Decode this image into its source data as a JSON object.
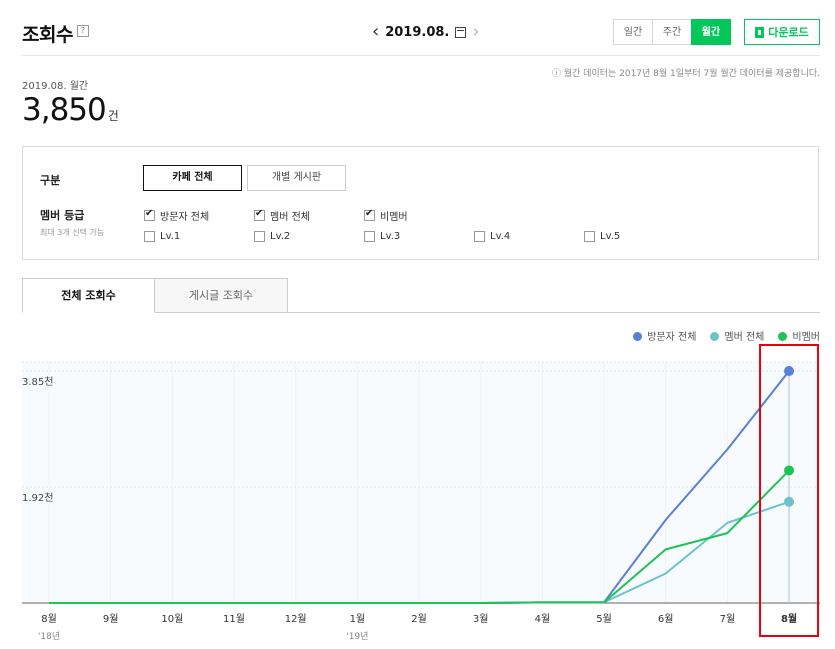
{
  "header": {
    "title": "조회수",
    "help": "?",
    "date": "2019.08.",
    "view_modes": [
      "일간",
      "주간",
      "월간"
    ],
    "active_mode": "월간",
    "download_label": "다운로드"
  },
  "notice": "ⓘ 월간 데이터는 2017년 8월 1일부터 7월 월간 데이터를 제공합니다.",
  "summary": {
    "period": "2019.08. 월간",
    "value": "3,850",
    "unit": "건"
  },
  "filter": {
    "category_label": "구분",
    "category_buttons": [
      "카페 전체",
      "개별 게시판"
    ],
    "member_label": "멤버 등급",
    "member_sub": "최대 3개 선택 가능",
    "row1": [
      {
        "label": "방문자 전체",
        "checked": true
      },
      {
        "label": "멤버 전체",
        "checked": true
      },
      {
        "label": "비멤버",
        "checked": true
      }
    ],
    "row2": [
      {
        "label": "Lv.1",
        "checked": false
      },
      {
        "label": "Lv.2",
        "checked": false
      },
      {
        "label": "Lv.3",
        "checked": false
      },
      {
        "label": "Lv.4",
        "checked": false
      },
      {
        "label": "Lv.5",
        "checked": false
      }
    ]
  },
  "tabs": [
    "전체 조회수",
    "게시글 조회수"
  ],
  "chart_data": {
    "type": "line",
    "categories": [
      "8월",
      "9월",
      "10월",
      "11월",
      "12월",
      "1월",
      "2월",
      "3월",
      "4월",
      "5월",
      "6월",
      "7월",
      "8월"
    ],
    "year_labels": {
      "0": "'18년",
      "5": "'19년"
    },
    "ytick_labels": [
      "3.85천",
      "1.92천"
    ],
    "ylim": [
      0,
      4000
    ],
    "yticks": [
      3850,
      1925
    ],
    "highlight_index": 12,
    "series": [
      {
        "name": "방문자 전체",
        "color": "#5b7fd4",
        "values": [
          0,
          0,
          0,
          0,
          0,
          0,
          0,
          0,
          10,
          10,
          1380,
          2550,
          3850
        ]
      },
      {
        "name": "멤버 전체",
        "color": "#6cc3cc",
        "values": [
          0,
          0,
          0,
          0,
          0,
          0,
          0,
          0,
          10,
          10,
          490,
          1330,
          1680
        ]
      },
      {
        "name": "비멤버",
        "color": "#1fc254",
        "values": [
          0,
          0,
          0,
          0,
          0,
          0,
          0,
          0,
          10,
          10,
          890,
          1160,
          2200
        ]
      }
    ]
  }
}
